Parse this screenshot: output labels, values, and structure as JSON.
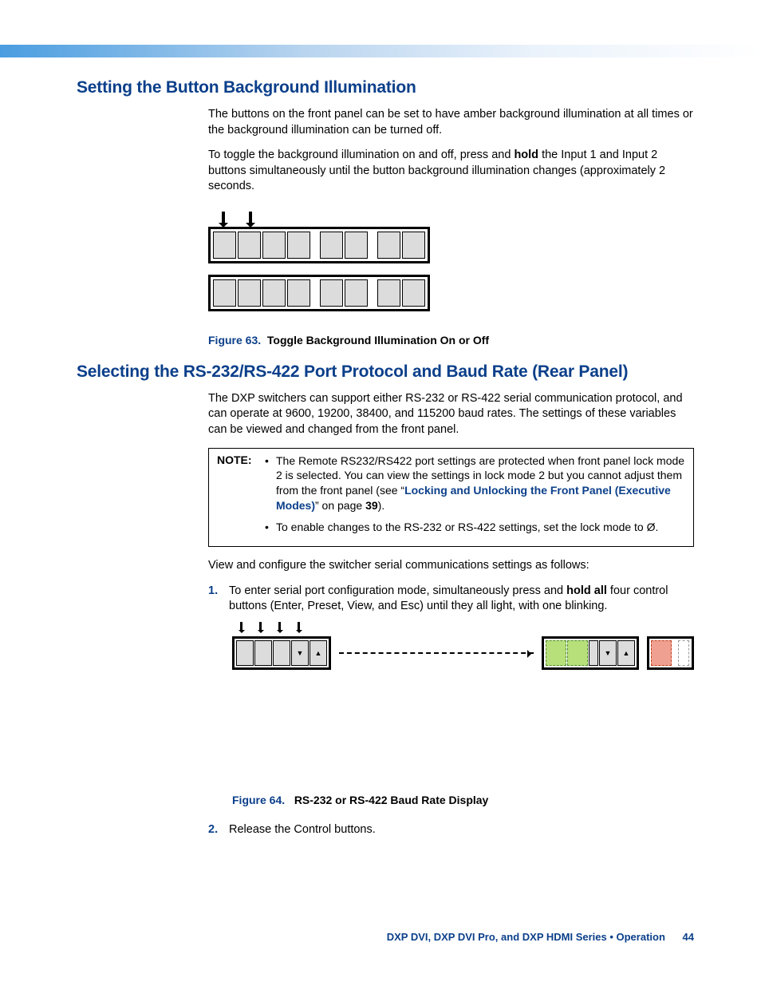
{
  "section1": {
    "heading": "Setting the Button Background Illumination",
    "p1": "The buttons on the front panel can be set to have amber background illumination at all times or the background illumination can be turned off.",
    "p2_a": "To toggle the background illumination on and off, press and ",
    "p2_bold": "hold",
    "p2_b": " the Input 1 and Input 2 buttons simultaneously until the button background illumination changes (approximately 2 seconds.",
    "fig_num": "Figure 63.",
    "fig_title": "Toggle Background Illumination On or Off"
  },
  "section2": {
    "heading": "Selecting the RS-232/RS-422 Port Protocol and Baud Rate (Rear Panel)",
    "p1": "The DXP switchers can support either RS-232 or RS-422 serial communication protocol, and can operate at 9600, 19200, 38400, and 115200 baud rates. The settings of these variables can be viewed and changed from the front panel.",
    "note_label": "NOTE:",
    "note1_a": "The Remote RS232/RS422 port settings are protected when front panel lock mode 2 is selected. You can view the settings in lock mode 2 but you cannot adjust them from the front panel (see “",
    "note1_link": "Locking and Unlocking the Front Panel (Executive Modes)",
    "note1_b": "” on page ",
    "note1_page": "39",
    "note1_c": ").",
    "note2": "To enable changes to the RS-232 or RS-422 settings, set the lock mode to Ø.",
    "p2": "View and configure the switcher serial communications settings as follows:",
    "step1_num": "1.",
    "step1_a": "To enter serial port configuration mode, simultaneously press and ",
    "step1_bold": "hold all",
    "step1_b": " four control buttons (Enter, Preset, View, and Esc) until they all light, with one blinking.",
    "fig_num": "Figure 64.",
    "fig_title": "RS-232 or RS-422 Baud Rate Display",
    "step2_num": "2.",
    "step2": "Release the Control buttons."
  },
  "footer": {
    "text": "DXP DVI, DXP DVI Pro, and DXP HDMI Series • Operation",
    "page": "44"
  },
  "glyphs": {
    "tri_down": "▼",
    "tri_up": "▲",
    "bullet": "•"
  }
}
